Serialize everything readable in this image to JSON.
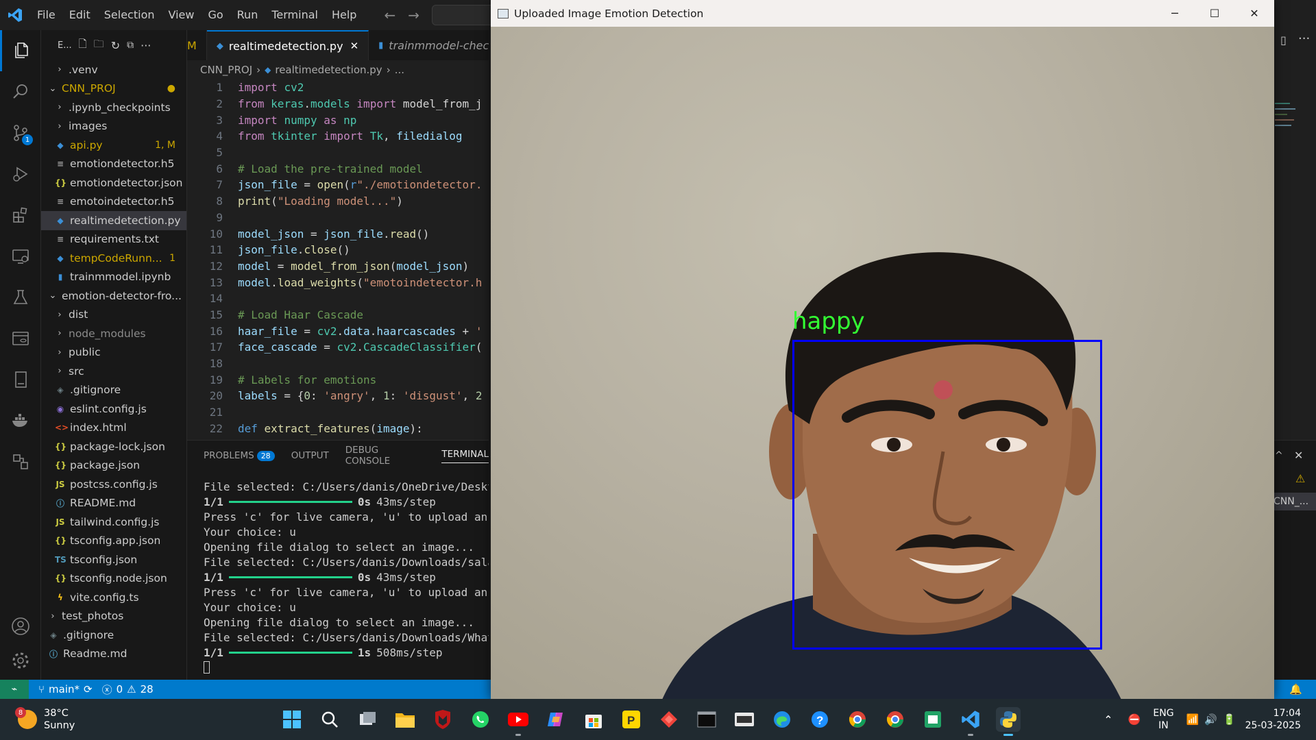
{
  "menu": [
    "File",
    "Edit",
    "Selection",
    "View",
    "Go",
    "Run",
    "Terminal",
    "Help"
  ],
  "activity": {
    "scm_badge": "1"
  },
  "explorer": {
    "header": "E...",
    "items": [
      {
        "label": ".venv",
        "type": "folder",
        "indent": 1,
        "color": "#cccccc",
        "status": ""
      },
      {
        "label": "CNN_PROJ",
        "type": "folder-open",
        "indent": 0,
        "color": "#cca700",
        "status": "●"
      },
      {
        "label": ".ipynb_checkpoints",
        "type": "folder",
        "indent": 1,
        "color": "#cccccc",
        "status": ""
      },
      {
        "label": "images",
        "type": "folder",
        "indent": 1,
        "color": "#cccccc",
        "status": ""
      },
      {
        "label": "api.py",
        "type": "py",
        "indent": 1,
        "color": "#cca700",
        "status": "1, M"
      },
      {
        "label": "emotiondetector.h5",
        "type": "txt",
        "indent": 1,
        "color": "#cccccc",
        "status": ""
      },
      {
        "label": "emotiondetector.json",
        "type": "json",
        "indent": 1,
        "color": "#cccccc",
        "status": ""
      },
      {
        "label": "emotoindetector.h5",
        "type": "txt",
        "indent": 1,
        "color": "#cccccc",
        "status": ""
      },
      {
        "label": "realtimedetection.py",
        "type": "py",
        "indent": 1,
        "color": "#cccccc",
        "status": "",
        "selected": true
      },
      {
        "label": "requirements.txt",
        "type": "txt",
        "indent": 1,
        "color": "#cccccc",
        "status": ""
      },
      {
        "label": "tempCodeRunn...",
        "type": "py",
        "indent": 1,
        "color": "#cca700",
        "status": "1"
      },
      {
        "label": "trainmmodel.ipynb",
        "type": "nb",
        "indent": 1,
        "color": "#cccccc",
        "status": ""
      },
      {
        "label": "emotion-detector-fro...",
        "type": "folder-open",
        "indent": 0,
        "color": "#cccccc",
        "status": ""
      },
      {
        "label": "dist",
        "type": "folder",
        "indent": 1,
        "color": "#cccccc",
        "status": ""
      },
      {
        "label": "node_modules",
        "type": "folder",
        "indent": 1,
        "color": "#8b8b8b",
        "status": ""
      },
      {
        "label": "public",
        "type": "folder",
        "indent": 1,
        "color": "#cccccc",
        "status": ""
      },
      {
        "label": "src",
        "type": "folder",
        "indent": 1,
        "color": "#cccccc",
        "status": ""
      },
      {
        "label": ".gitignore",
        "type": "git",
        "indent": 1,
        "color": "#cccccc",
        "status": ""
      },
      {
        "label": "eslint.config.js",
        "type": "eslint",
        "indent": 1,
        "color": "#cccccc",
        "status": ""
      },
      {
        "label": "index.html",
        "type": "html",
        "indent": 1,
        "color": "#cccccc",
        "status": ""
      },
      {
        "label": "package-lock.json",
        "type": "json",
        "indent": 1,
        "color": "#cccccc",
        "status": ""
      },
      {
        "label": "package.json",
        "type": "json",
        "indent": 1,
        "color": "#cccccc",
        "status": ""
      },
      {
        "label": "postcss.config.js",
        "type": "js",
        "indent": 1,
        "color": "#cccccc",
        "status": ""
      },
      {
        "label": "README.md",
        "type": "info",
        "indent": 1,
        "color": "#cccccc",
        "status": ""
      },
      {
        "label": "tailwind.config.js",
        "type": "js",
        "indent": 1,
        "color": "#cccccc",
        "status": ""
      },
      {
        "label": "tsconfig.app.json",
        "type": "json",
        "indent": 1,
        "color": "#cccccc",
        "status": ""
      },
      {
        "label": "tsconfig.json",
        "type": "ts",
        "indent": 1,
        "color": "#cccccc",
        "status": ""
      },
      {
        "label": "tsconfig.node.json",
        "type": "json",
        "indent": 1,
        "color": "#cccccc",
        "status": ""
      },
      {
        "label": "vite.config.ts",
        "type": "vite",
        "indent": 1,
        "color": "#cccccc",
        "status": ""
      },
      {
        "label": "test_photos",
        "type": "folder",
        "indent": 0,
        "color": "#cccccc",
        "status": ""
      },
      {
        "label": ".gitignore",
        "type": "git",
        "indent": 0,
        "color": "#cccccc",
        "status": ""
      },
      {
        "label": "Readme.md",
        "type": "info",
        "indent": 0,
        "color": "#cccccc",
        "status": ""
      }
    ]
  },
  "tabs": {
    "left_fragment": "M",
    "active": "realtimedetection.py",
    "inactive": "trainmmodel-chec"
  },
  "breadcrumb": [
    "CNN_PROJ",
    "realtimedetection.py",
    "..."
  ],
  "code_lines": [
    {
      "n": "1",
      "parts": [
        [
          "kw",
          "import"
        ],
        [
          "plain",
          " "
        ],
        [
          "mod",
          "cv2"
        ]
      ]
    },
    {
      "n": "2",
      "parts": [
        [
          "kw",
          "from"
        ],
        [
          "plain",
          " "
        ],
        [
          "mod",
          "keras"
        ],
        [
          "plain",
          "."
        ],
        [
          "mod",
          "models"
        ],
        [
          "plain",
          " "
        ],
        [
          "kw",
          "import"
        ],
        [
          "plain",
          " model_from_j"
        ]
      ]
    },
    {
      "n": "3",
      "parts": [
        [
          "kw",
          "import"
        ],
        [
          "plain",
          " "
        ],
        [
          "mod",
          "numpy"
        ],
        [
          "plain",
          " "
        ],
        [
          "kw",
          "as"
        ],
        [
          "plain",
          " "
        ],
        [
          "mod",
          "np"
        ]
      ]
    },
    {
      "n": "4",
      "parts": [
        [
          "kw",
          "from"
        ],
        [
          "plain",
          " "
        ],
        [
          "mod",
          "tkinter"
        ],
        [
          "plain",
          " "
        ],
        [
          "kw",
          "import"
        ],
        [
          "plain",
          " "
        ],
        [
          "mod",
          "Tk"
        ],
        [
          "plain",
          ", "
        ],
        [
          "var",
          "filedialog"
        ]
      ]
    },
    {
      "n": "5",
      "parts": []
    },
    {
      "n": "6",
      "parts": [
        [
          "cm",
          "# Load the pre-trained model"
        ]
      ]
    },
    {
      "n": "7",
      "parts": [
        [
          "var",
          "json_file"
        ],
        [
          "plain",
          " = "
        ],
        [
          "fn",
          "open"
        ],
        [
          "plain",
          "("
        ],
        [
          "def",
          "r"
        ],
        [
          "str",
          "\"./emotiondetector."
        ]
      ]
    },
    {
      "n": "8",
      "parts": [
        [
          "fn",
          "print"
        ],
        [
          "plain",
          "("
        ],
        [
          "str",
          "\"Loading model...\""
        ],
        [
          "plain",
          ")"
        ]
      ]
    },
    {
      "n": "9",
      "parts": []
    },
    {
      "n": "10",
      "parts": [
        [
          "var",
          "model_json"
        ],
        [
          "plain",
          " = "
        ],
        [
          "var",
          "json_file"
        ],
        [
          "plain",
          "."
        ],
        [
          "fn",
          "read"
        ],
        [
          "plain",
          "()"
        ]
      ]
    },
    {
      "n": "11",
      "parts": [
        [
          "var",
          "json_file"
        ],
        [
          "plain",
          "."
        ],
        [
          "fn",
          "close"
        ],
        [
          "plain",
          "()"
        ]
      ]
    },
    {
      "n": "12",
      "parts": [
        [
          "var",
          "model"
        ],
        [
          "plain",
          " = "
        ],
        [
          "fn",
          "model_from_json"
        ],
        [
          "plain",
          "("
        ],
        [
          "var",
          "model_json"
        ],
        [
          "plain",
          ")"
        ]
      ]
    },
    {
      "n": "13",
      "parts": [
        [
          "var",
          "model"
        ],
        [
          "plain",
          "."
        ],
        [
          "fn",
          "load_weights"
        ],
        [
          "plain",
          "("
        ],
        [
          "str",
          "\"emotoindetector.h"
        ]
      ]
    },
    {
      "n": "14",
      "parts": []
    },
    {
      "n": "15",
      "parts": [
        [
          "cm",
          "# Load Haar Cascade"
        ]
      ]
    },
    {
      "n": "16",
      "parts": [
        [
          "var",
          "haar_file"
        ],
        [
          "plain",
          " = "
        ],
        [
          "mod",
          "cv2"
        ],
        [
          "plain",
          "."
        ],
        [
          "var",
          "data"
        ],
        [
          "plain",
          "."
        ],
        [
          "var",
          "haarcascades"
        ],
        [
          "plain",
          " + "
        ],
        [
          "str",
          "'"
        ]
      ]
    },
    {
      "n": "17",
      "parts": [
        [
          "var",
          "face_cascade"
        ],
        [
          "plain",
          " = "
        ],
        [
          "mod",
          "cv2"
        ],
        [
          "plain",
          "."
        ],
        [
          "mod",
          "CascadeClassifier"
        ],
        [
          "plain",
          "("
        ]
      ]
    },
    {
      "n": "18",
      "parts": []
    },
    {
      "n": "19",
      "parts": [
        [
          "cm",
          "# Labels for emotions"
        ]
      ]
    },
    {
      "n": "20",
      "parts": [
        [
          "var",
          "labels"
        ],
        [
          "plain",
          " = {"
        ],
        [
          "num",
          "0"
        ],
        [
          "plain",
          ": "
        ],
        [
          "str",
          "'angry'"
        ],
        [
          "plain",
          ", "
        ],
        [
          "num",
          "1"
        ],
        [
          "plain",
          ": "
        ],
        [
          "str",
          "'disgust'"
        ],
        [
          "plain",
          ", "
        ],
        [
          "num",
          "2"
        ]
      ]
    },
    {
      "n": "21",
      "parts": []
    },
    {
      "n": "22",
      "parts": [
        [
          "def",
          "def"
        ],
        [
          "plain",
          " "
        ],
        [
          "fn",
          "extract_features"
        ],
        [
          "plain",
          "("
        ],
        [
          "var",
          "image"
        ],
        [
          "plain",
          "):"
        ]
      ]
    }
  ],
  "panel": {
    "tabs": [
      "PROBLEMS",
      "OUTPUT",
      "DEBUG CONSOLE",
      "TERMINAL"
    ],
    "problems_count": "28",
    "terminal_lines": [
      {
        "text": "File selected: C:/Users/danis/OneDrive/Desktop/",
        "progress": false
      },
      {
        "step": "1/1",
        "time": "0s",
        "rate": "43ms/step",
        "progress": true
      },
      {
        "text": "Press 'c' for live camera, 'u' to upload an ima",
        "progress": false
      },
      {
        "text": "Your choice: u",
        "progress": false
      },
      {
        "text": "Opening file dialog to select an image...",
        "progress": false
      },
      {
        "text": "File selected: C:/Users/danis/Downloads/salaman",
        "progress": false
      },
      {
        "step": "1/1",
        "time": "0s",
        "rate": "43ms/step",
        "progress": true
      },
      {
        "text": "Press 'c' for live camera, 'u' to upload an ima",
        "progress": false
      },
      {
        "text": "Your choice: u",
        "progress": false
      },
      {
        "text": "Opening file dialog to select an image...",
        "progress": false
      },
      {
        "text": "File selected: C:/Users/danis/Downloads/WhatsAp",
        "progress": false
      },
      {
        "step": "1/1",
        "time": "1s",
        "rate": "508ms/step",
        "progress": true
      }
    ]
  },
  "statusbar": {
    "branch": "main*",
    "errors": "0",
    "warnings": "28"
  },
  "right_remnants": {
    "panel_label": "CNN_..."
  },
  "image_window": {
    "title": "Uploaded Image Emotion Detection",
    "detection_label": "happy",
    "box_color": "#0000ff",
    "label_color": "#33ff33"
  },
  "taskbar": {
    "weather_temp": "38°C",
    "weather_desc": "Sunny",
    "weather_badge": "8",
    "lang_top": "ENG",
    "lang_bottom": "IN",
    "time": "17:04",
    "date": "25-03-2025"
  }
}
